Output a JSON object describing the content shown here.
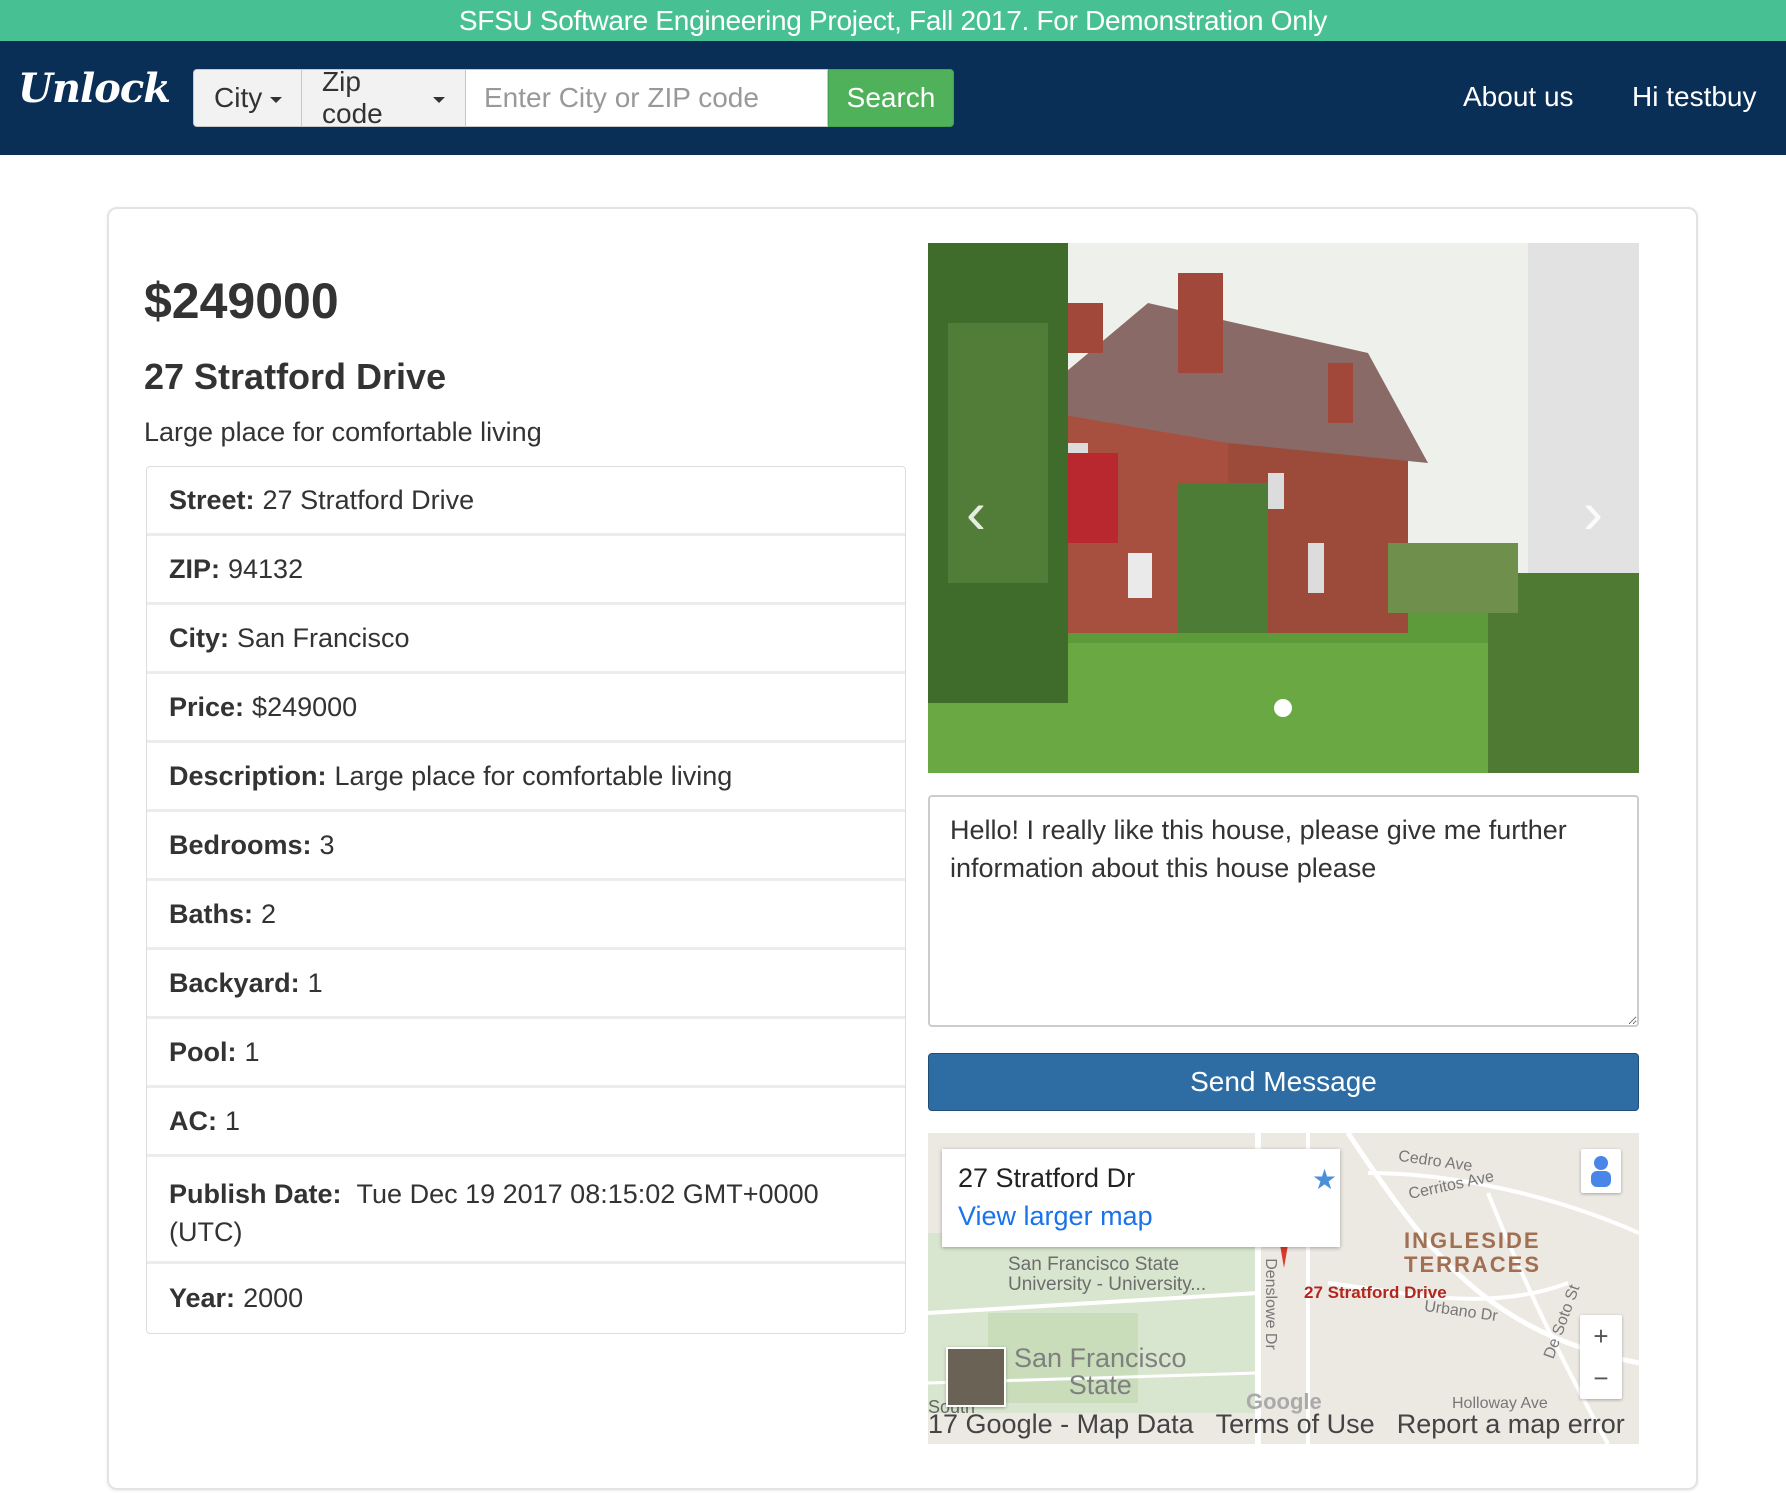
{
  "banner": {
    "text": "SFSU Software Engineering Project, Fall 2017. For Demonstration Only"
  },
  "header": {
    "logo": "Unlock",
    "city_dropdown": "City",
    "zip_dropdown": "Zip code",
    "search_placeholder": "Enter City or ZIP code",
    "search_value": "",
    "search_button": "Search",
    "nav": {
      "about": "About us",
      "user": "Hi testbuy"
    }
  },
  "listing": {
    "price": "$249000",
    "title": "27 Stratford Drive",
    "tagline": "Large place for comfortable living",
    "details": [
      {
        "label": "Street:",
        "value": "27 Stratford Drive"
      },
      {
        "label": "ZIP:",
        "value": "94132"
      },
      {
        "label": "City:",
        "value": "San Francisco"
      },
      {
        "label": "Price:",
        "value": "$249000"
      },
      {
        "label": "Description:",
        "value": "Large place for comfortable living"
      },
      {
        "label": "Bedrooms:",
        "value": "3"
      },
      {
        "label": "Baths:",
        "value": "2"
      },
      {
        "label": "Backyard:",
        "value": "1"
      },
      {
        "label": "Pool:",
        "value": "1"
      },
      {
        "label": "AC:",
        "value": "1"
      },
      {
        "label": "Publish Date:",
        "value": "Tue Dec 19 2017 08:15:02 GMT+0000 (UTC)"
      },
      {
        "label": "Year:",
        "value": "2000"
      }
    ]
  },
  "carousel": {
    "prev_icon": "chevron-left-icon",
    "next_icon": "chevron-right-icon",
    "active_index": 1,
    "total": 1
  },
  "message": {
    "text": "Hello! I really like this house, please give me further information about this house please",
    "send_button": "Send Message"
  },
  "map": {
    "card_title": "27 Stratford Dr",
    "card_link": "View larger map",
    "pin_label": "27 Stratford Drive",
    "labels": {
      "university": "San Francisco State\nUniversity - University...",
      "campus": "San Francisco\nState",
      "area": "INGLESIDE\nTERRACES",
      "cedro": "Cedro Ave",
      "cerritos": "Cerritos Ave",
      "urbano": "Urbano Dr",
      "desoto": "De Soto St",
      "denslowe": "Denslowe Dr",
      "holloway": "Holloway Ave",
      "south": "South"
    },
    "google": "Google",
    "footer": [
      "17 Google - Map Data",
      "Terms of Use",
      "Report a map error"
    ],
    "zoom_in": "+",
    "zoom_out": "−"
  },
  "colors": {
    "banner": "#47c193",
    "navbar": "#0a2f57",
    "search_button": "#4fb25a",
    "send_button": "#2e6da4"
  }
}
